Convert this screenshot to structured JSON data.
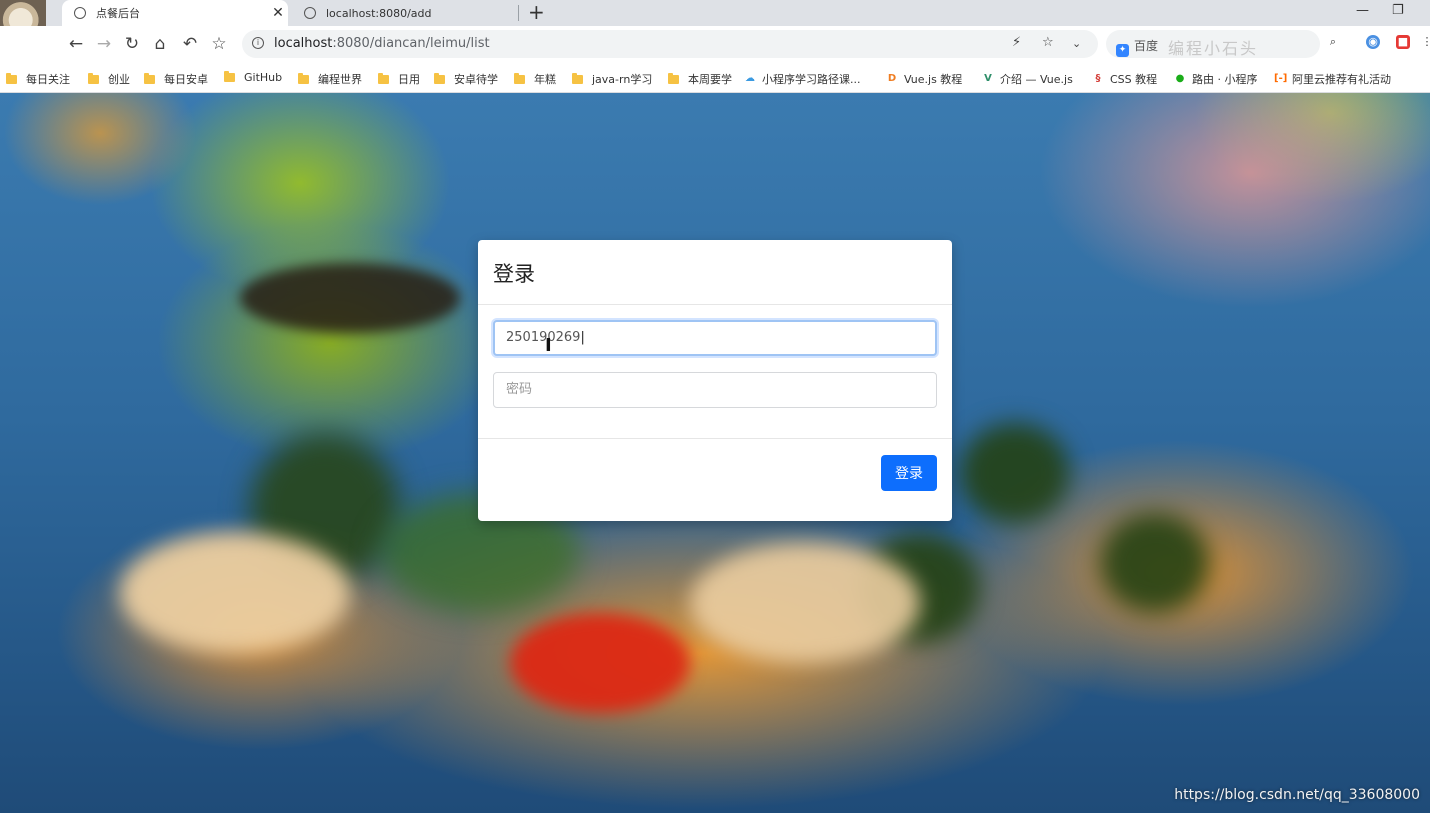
{
  "browser": {
    "tabs": [
      {
        "title": "点餐后台",
        "active": true
      },
      {
        "title": "localhost:8080/add",
        "active": false
      }
    ],
    "new_tab": "+",
    "window_controls": {
      "minimize": "—",
      "restore": "❐"
    },
    "url_host": "localhost",
    "url_rest": ":8080/diancan/leimu/list",
    "search_engine": "百度",
    "search_ghost_text": "编程小石头"
  },
  "bookmarks": [
    {
      "label": "每日关注",
      "type": "folder"
    },
    {
      "label": "创业",
      "type": "folder"
    },
    {
      "label": "每日安卓",
      "type": "folder"
    },
    {
      "label": "GitHub",
      "type": "folder"
    },
    {
      "label": "编程世界",
      "type": "folder"
    },
    {
      "label": "日用",
      "type": "folder"
    },
    {
      "label": "安卓待学",
      "type": "folder"
    },
    {
      "label": "年糕",
      "type": "folder"
    },
    {
      "label": "java-rn学习",
      "type": "folder"
    },
    {
      "label": "本周要学",
      "type": "folder"
    },
    {
      "label": "小程序学习路径课...",
      "type": "link",
      "icon": "cloud-icon"
    },
    {
      "label": "Vue.js 教程",
      "type": "link",
      "icon": "d-icon"
    },
    {
      "label": "介绍 — Vue.js",
      "type": "link",
      "icon": "vue-icon"
    },
    {
      "label": "CSS 教程",
      "type": "link",
      "icon": "css-icon"
    },
    {
      "label": "路由 · 小程序",
      "type": "link",
      "icon": "wechat-icon"
    },
    {
      "label": "阿里云推荐有礼活动",
      "type": "link",
      "icon": "aliyun-icon"
    }
  ],
  "modal": {
    "title": "登录",
    "username_value": "250190269",
    "password_placeholder": "密码",
    "submit_label": "登录"
  },
  "watermark": "https://blog.csdn.net/qq_33608000",
  "colors": {
    "primary_button": "#0d6efd",
    "focus_border": "#9fc4f4"
  }
}
